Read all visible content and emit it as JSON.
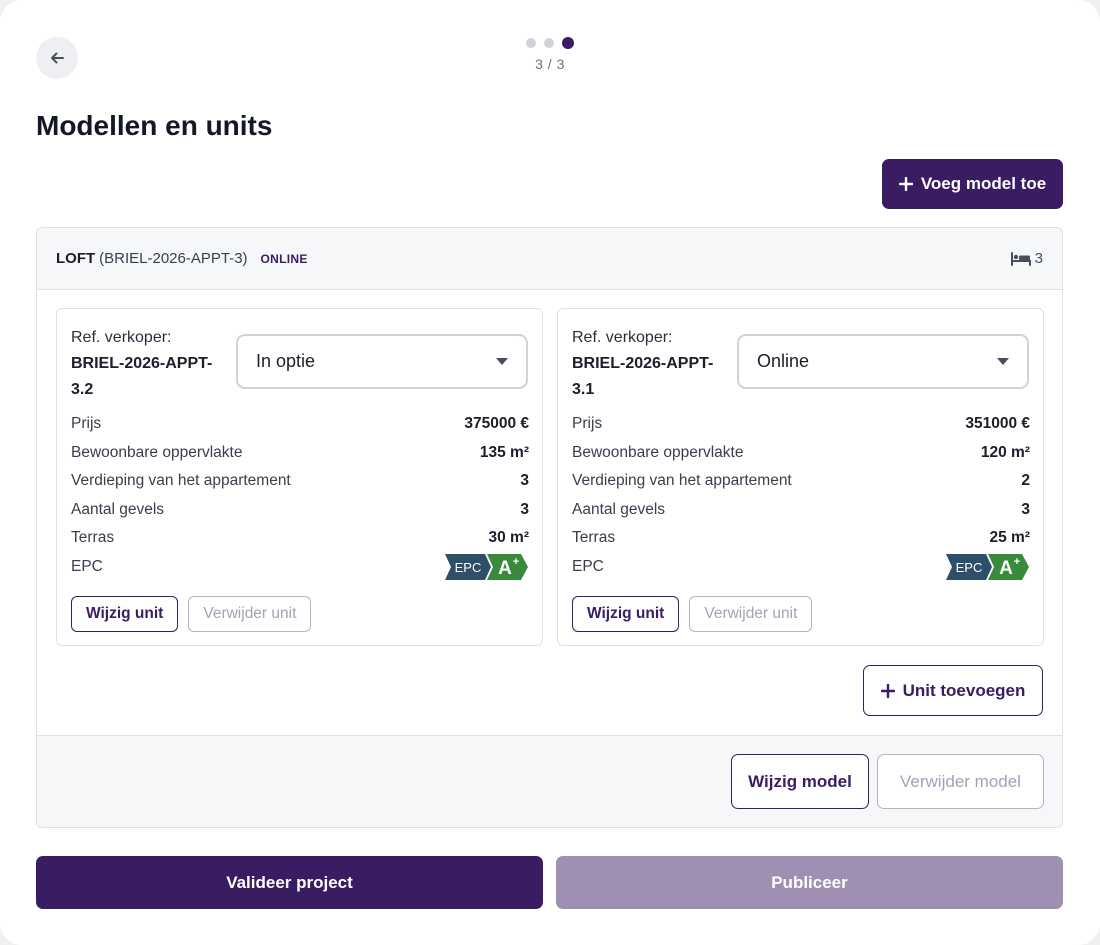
{
  "stepper": {
    "current": 3,
    "total": 3,
    "label": "3 / 3"
  },
  "page": {
    "title": "Modellen en units"
  },
  "actions": {
    "add_model_label": "Voeg model toe"
  },
  "model": {
    "name": "LOFT",
    "ref": "(BRIEL-2026-APPT-3)",
    "status": "ONLINE",
    "bedrooms": "3",
    "add_unit_label": "Unit toevoegen",
    "edit_label": "Wijzig model",
    "delete_label": "Verwijder model",
    "units": [
      {
        "ref_label": "Ref. verkoper:",
        "ref_code": "BRIEL-2026-APPT-3.2",
        "status": "In optie",
        "properties": [
          {
            "label": "Prijs",
            "value": "375000 €"
          },
          {
            "label": "Bewoonbare oppervlakte",
            "value": "135 m²"
          },
          {
            "label": "Verdieping van het appartement",
            "value": "3"
          },
          {
            "label": "Aantal gevels",
            "value": "3"
          },
          {
            "label": "Terras",
            "value": "30 m²"
          },
          {
            "label": "EPC",
            "value": "A+"
          }
        ],
        "edit_label": "Wijzig unit",
        "delete_label": "Verwijder unit"
      },
      {
        "ref_label": "Ref. verkoper:",
        "ref_code": "BRIEL-2026-APPT-3.1",
        "status": "Online",
        "properties": [
          {
            "label": "Prijs",
            "value": "351000 €"
          },
          {
            "label": "Bewoonbare oppervlakte",
            "value": "120 m²"
          },
          {
            "label": "Verdieping van het appartement",
            "value": "2"
          },
          {
            "label": "Aantal gevels",
            "value": "3"
          },
          {
            "label": "Terras",
            "value": "25 m²"
          },
          {
            "label": "EPC",
            "value": "A+"
          }
        ],
        "edit_label": "Wijzig unit",
        "delete_label": "Verwijder unit"
      }
    ]
  },
  "epc": {
    "prefix": "EPC",
    "grade": "A",
    "grade_sup": "+"
  },
  "footer": {
    "validate_label": "Valideer project",
    "publish_label": "Publiceer"
  },
  "colors": {
    "primary": "#3a1c63",
    "primary_disabled": "#9e8fb3",
    "epc_dark": "#2d4f68",
    "epc_green": "#3a8a3c"
  },
  "icons": {
    "back": "arrow-left-icon",
    "add": "plus-icon",
    "bed": "bed-icon",
    "caret": "caret-down-icon"
  }
}
